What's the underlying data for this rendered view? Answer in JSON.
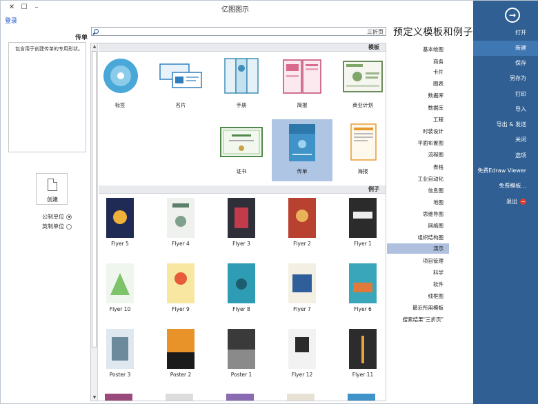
{
  "window": {
    "title": "亿图图示",
    "login": "登录"
  },
  "left_panel": {
    "heading": "传单",
    "description": "包含用于创建传单的专用形状。",
    "create_label": "创建",
    "units": [
      {
        "label": "公制单位",
        "selected": true
      },
      {
        "label": "英制单位",
        "selected": false
      }
    ]
  },
  "search": {
    "text": "三折页"
  },
  "main": {
    "heading": "预定义模板和例子",
    "templates_header": "模板",
    "examples_header": "例子",
    "templates": [
      "商业计划",
      "简报",
      "手册",
      "名片",
      "标签",
      "海报",
      "传单",
      "证书"
    ],
    "examples": [
      "Flyer 1",
      "Flyer 2",
      "Flyer 3",
      "Flyer 4",
      "Flyer 5",
      "Flyer 6",
      "Flyer 7",
      "Flyer 8",
      "Flyer 9",
      "Flyer 10",
      "Flyer 11",
      "Flyer 12",
      "Poster 1",
      "Poster 2",
      "Poster 3"
    ]
  },
  "categories": [
    "基本绘图",
    "商务",
    "卡片",
    "图表",
    "数据库",
    "数据库",
    "工程",
    "时装设计",
    "平面布置图",
    "流程图",
    "表格",
    "工业自动化",
    "信息图",
    "地图",
    "思维导图",
    "网络图",
    "组织结构图",
    "演示",
    "项目管理",
    "科学",
    "软件",
    "线框图",
    "最近所用模板",
    "搜索结果\"三折页\""
  ],
  "sidebar": {
    "items": [
      "打开",
      "新建",
      "保存",
      "另存为",
      "打印",
      "导入",
      "导出 & 发送",
      "关闭",
      "选项",
      "免费Edraw Viewer",
      "免费模板...",
      "退出"
    ]
  },
  "colors": {
    "sidebar": "#2f5f93",
    "sidebar_active": "#3f77b3",
    "selected_tile": "#aec6e4",
    "category_active": "#aec0de",
    "exit_icon": "#e8362c"
  }
}
